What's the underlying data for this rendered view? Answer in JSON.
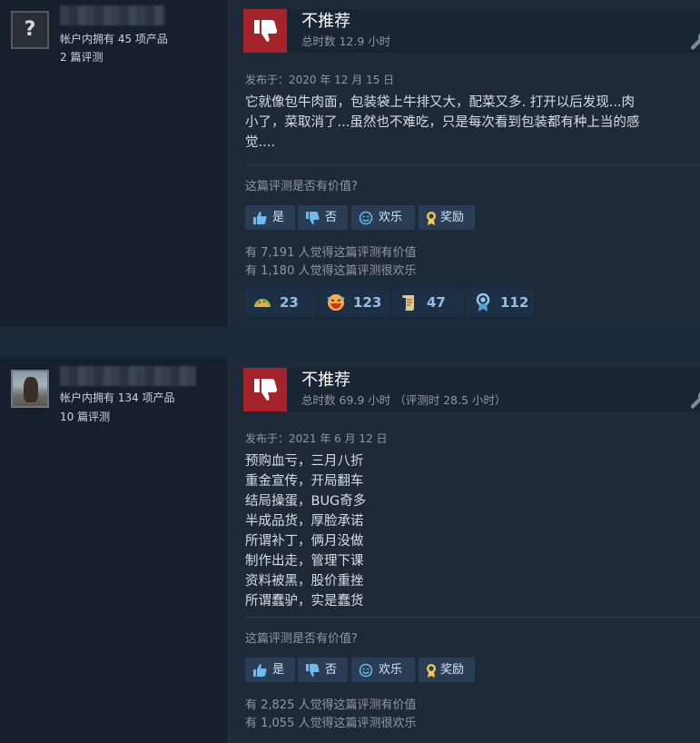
{
  "reviews": [
    {
      "author": {
        "products": "帐户内拥有 45 项产品",
        "reviews": "2 篇评测"
      },
      "recommendation": "不推荐",
      "hours": "总时数 12.9 小时",
      "posted": "发布于：2020 年 12 月 15 日",
      "body": [
        "它就像包牛肉面，包装袋上牛排又大，配菜又多. 打开以后发现...肉",
        "小了，菜取消了...虽然也不难吃，只是每次看到包装都有种上当的感",
        "觉...."
      ],
      "helpful_question": "这篇评测是否有价值?",
      "buttons": {
        "yes": "是",
        "no": "否",
        "funny": "欢乐",
        "award": "奖励"
      },
      "stats": {
        "helpful": "有 7,191 人觉得这篇评测有价值",
        "funny": "有 1,180 人觉得这篇评测很欢乐"
      },
      "awards": [
        {
          "icon": "taco-award-icon",
          "count": "23"
        },
        {
          "icon": "laughing-face-award-icon",
          "count": "123"
        },
        {
          "icon": "scroll-award-icon",
          "count": "47"
        },
        {
          "icon": "medal-award-icon",
          "count": "112"
        }
      ]
    },
    {
      "author": {
        "products": "帐户内拥有 134 项产品",
        "reviews": "10 篇评测"
      },
      "recommendation": "不推荐",
      "hours": "总时数 69.9 小时 （评测时 28.5 小时）",
      "posted": "发布于：2021 年 6 月 12 日",
      "body": [
        "预购血亏，三月八折",
        "重金宣传，开局翻车",
        "结局操蛋，BUG奇多",
        "半成品货，厚脸承诺",
        "所谓补丁，俩月没做",
        "制作出走，管理下课",
        "资料被黑，股价重挫",
        "所谓蠢驴，实是蠢货"
      ],
      "helpful_question": "这篇评测是否有价值?",
      "buttons": {
        "yes": "是",
        "no": "否",
        "funny": "欢乐",
        "award": "奖励"
      },
      "stats": {
        "helpful": "有 2,825 人觉得这篇评测有价值",
        "funny": "有 1,055 人觉得这篇评测很欢乐"
      }
    }
  ],
  "colors": {
    "thumb_bg": "#a5232a",
    "button_bg": "#2a3d55",
    "award_count": "#93bfe6"
  }
}
